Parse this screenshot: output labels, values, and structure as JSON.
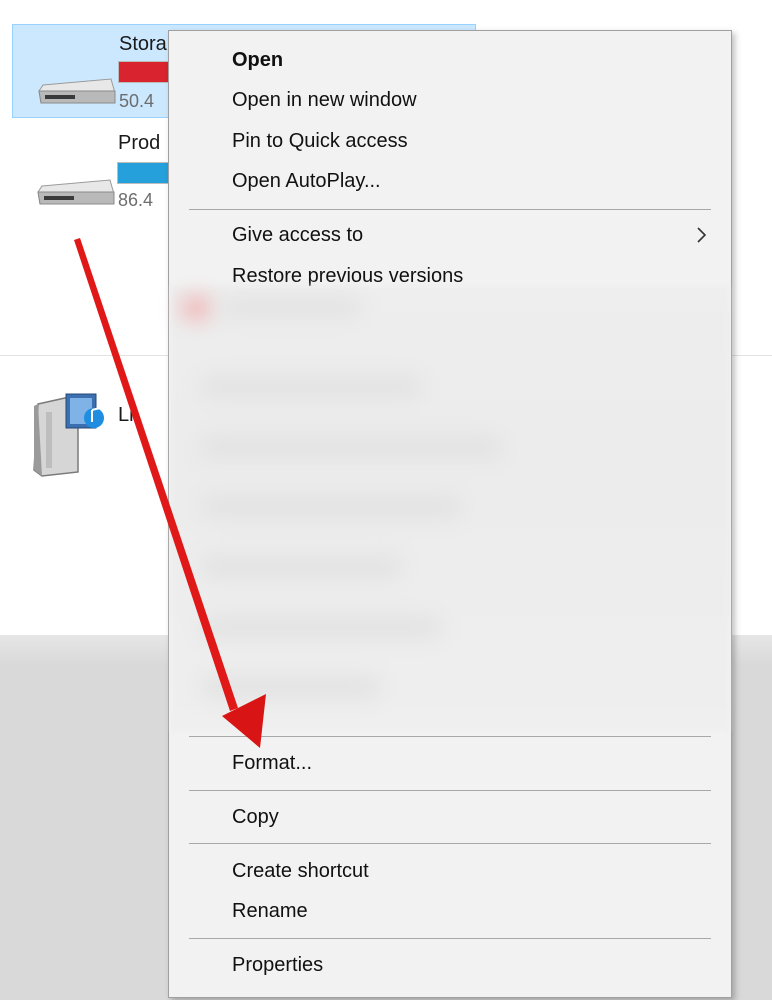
{
  "drives": [
    {
      "name": "Stora",
      "size": "50.4",
      "bar_color": "#d9232e",
      "usage": 1.0,
      "selected": true
    },
    {
      "name": "Prod",
      "size": "86.4",
      "bar_color": "#26a0da",
      "usage": 1.0,
      "selected": false
    }
  ],
  "media_item": {
    "label": "Li"
  },
  "context_menu": {
    "items": [
      {
        "label": "Open",
        "bold": true
      },
      {
        "label": "Open in new window"
      },
      {
        "label": "Pin to Quick access"
      },
      {
        "label": "Open AutoPlay..."
      },
      {
        "label": "Give access to",
        "has_submenu": true
      },
      {
        "label": "Restore previous versions"
      },
      {
        "label": "Format..."
      },
      {
        "label": "Copy"
      },
      {
        "label": "Create shortcut"
      },
      {
        "label": "Rename"
      },
      {
        "label": "Properties"
      }
    ]
  },
  "annotation": {
    "arrow_color": "#e01818"
  },
  "icons": {
    "drive": "hard-drive-icon",
    "media": "media-device-icon",
    "submenu": "chevron-right-icon"
  }
}
